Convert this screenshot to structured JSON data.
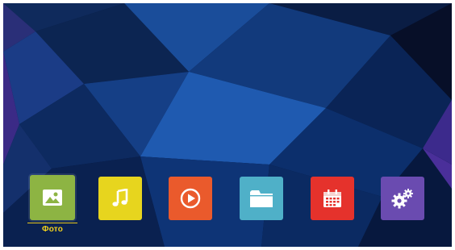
{
  "launcher": {
    "apps": [
      {
        "id": "photo",
        "label": "Фото",
        "icon": "image-icon",
        "color": "#8db443",
        "selected": true
      },
      {
        "id": "music",
        "label": "",
        "icon": "music-note-icon",
        "color": "#e7d51e",
        "selected": false
      },
      {
        "id": "video",
        "label": "",
        "icon": "play-icon",
        "color": "#ea5a2c",
        "selected": false
      },
      {
        "id": "files",
        "label": "",
        "icon": "folder-icon",
        "color": "#4fb0c8",
        "selected": false
      },
      {
        "id": "calendar",
        "label": "",
        "icon": "calendar-icon",
        "color": "#e5322c",
        "selected": false
      },
      {
        "id": "settings",
        "label": "",
        "icon": "gears-icon",
        "color": "#6a4bb0",
        "selected": false
      }
    ],
    "label_color": "#f2d21c"
  }
}
